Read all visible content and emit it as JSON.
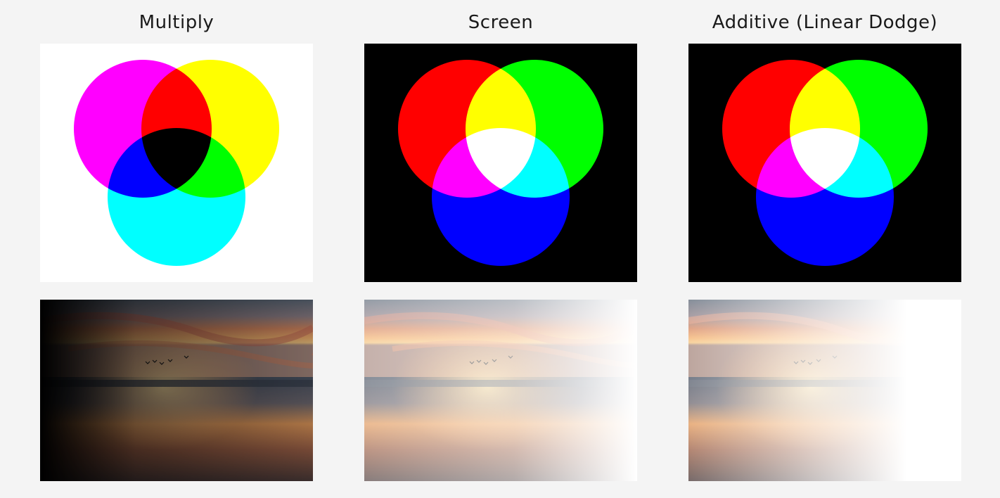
{
  "columns": [
    {
      "title": "Multiply",
      "background": "#ffffff",
      "blend": "multiply",
      "circle_colors": [
        "#ff00ff",
        "#ffff00",
        "#00ffff"
      ]
    },
    {
      "title": "Screen",
      "background": "#000000",
      "blend": "screen",
      "circle_colors": [
        "#ff0000",
        "#00ff00",
        "#0000ff"
      ]
    },
    {
      "title": "Additive (Linear Dodge)",
      "background": "#000000",
      "blend": "plus-lighter",
      "circle_colors": [
        "#ff0000",
        "#00ff00",
        "#0000ff"
      ]
    }
  ],
  "photo_subject": "sunset-beach-with-birds"
}
